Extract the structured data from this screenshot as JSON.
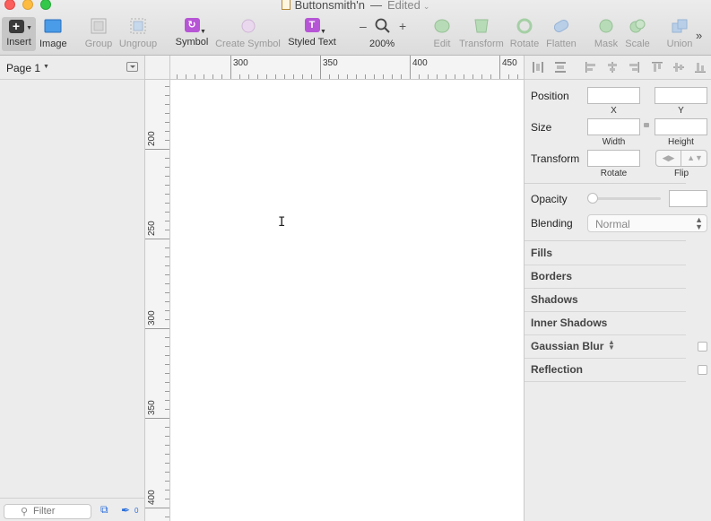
{
  "window": {
    "title": "Buttonsmith'n",
    "separator": "—",
    "status": "Edited"
  },
  "toolbar": {
    "insert": "Insert",
    "image": "Image",
    "group": "Group",
    "ungroup": "Ungroup",
    "symbol": "Symbol",
    "create_symbol": "Create Symbol",
    "styled_text": "Styled Text",
    "zoom_minus": "–",
    "zoom_plus": "+",
    "zoom_level": "200%",
    "edit": "Edit",
    "transform": "Transform",
    "rotate": "Rotate",
    "flatten": "Flatten",
    "mask": "Mask",
    "scale": "Scale",
    "union": "Union",
    "overflow": "»"
  },
  "layers": {
    "page": "Page 1",
    "filter_placeholder": "Filter",
    "count": "0"
  },
  "rulers": {
    "horizontal": [
      "300",
      "350",
      "400",
      "450"
    ],
    "vertical": [
      "200",
      "250",
      "300",
      "350",
      "400"
    ]
  },
  "inspector": {
    "position": "Position",
    "x": "X",
    "y": "Y",
    "size": "Size",
    "width": "Width",
    "height": "Height",
    "transform": "Transform",
    "rotate": "Rotate",
    "flip": "Flip",
    "opacity": "Opacity",
    "blending": "Blending",
    "blending_value": "Normal",
    "sections": [
      "Fills",
      "Borders",
      "Shadows",
      "Inner Shadows",
      "Gaussian Blur",
      "Reflection"
    ]
  }
}
